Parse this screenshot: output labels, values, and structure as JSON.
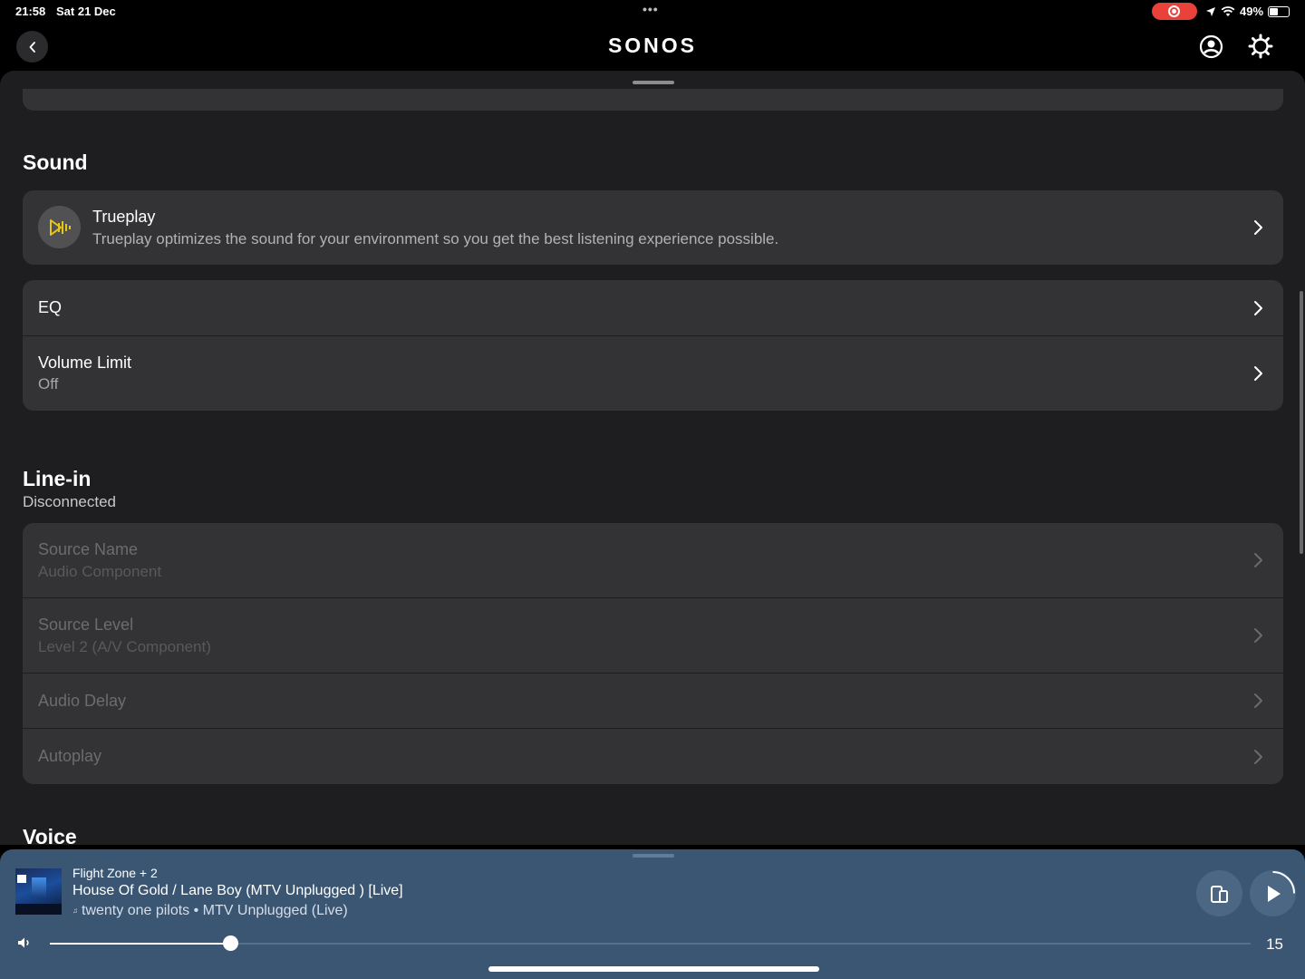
{
  "status": {
    "time": "21:58",
    "date": "Sat 21 Dec",
    "battery": "49%",
    "battery_level": 0.49
  },
  "nav": {
    "brand": "SONOS",
    "icons": [
      "chevron-left-icon",
      "account-icon",
      "gear-icon"
    ]
  },
  "sound": {
    "title": "Sound",
    "trueplay_title": "Trueplay",
    "trueplay_desc": "Trueplay optimizes the sound for your environment so you get the best listening experience possible.",
    "trueplay_icon_color": "#e6c619",
    "eq_label": "EQ",
    "volume_limit_label": "Volume Limit",
    "volume_limit_value": "Off"
  },
  "line_in": {
    "title": "Line-in",
    "status": "Disconnected",
    "source_name_label": "Source Name",
    "source_name_value": "Audio Component",
    "source_level_label": "Source Level",
    "source_level_value": "Level 2 (A/V Component)",
    "audio_delay_label": "Audio Delay",
    "autoplay_label": "Autoplay"
  },
  "voice": {
    "title": "Voice"
  },
  "player": {
    "zone": "Flight Zone + 2",
    "track": "House Of Gold / Lane Boy (MTV Unplugged ) [Live]",
    "artist_album": "twenty one pilots • MTV Unplugged (Live)",
    "service_icon": "music",
    "volume": "15",
    "volume_fraction": 0.15,
    "background_color": "#3a5673"
  }
}
